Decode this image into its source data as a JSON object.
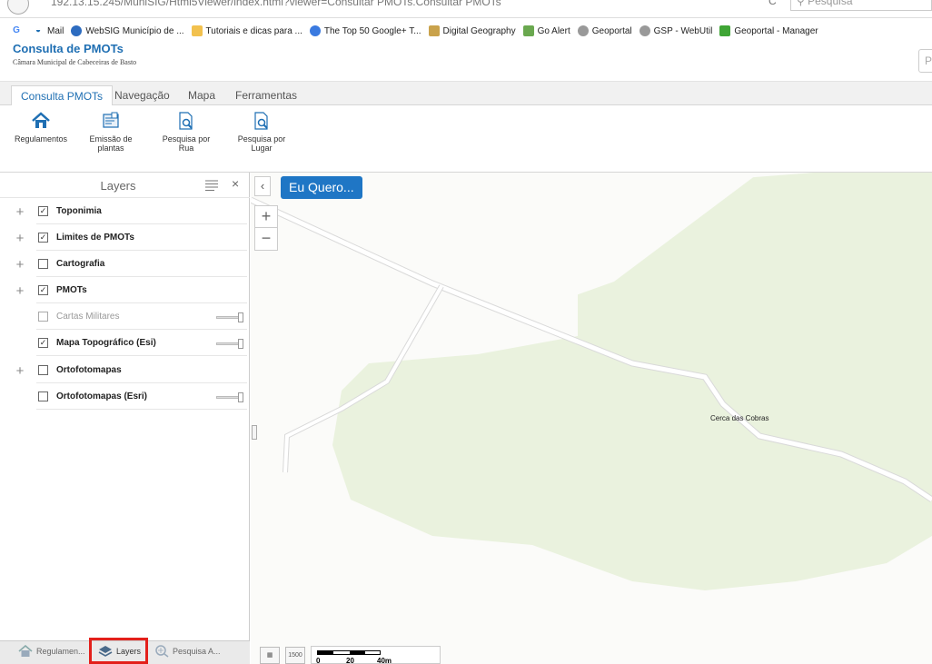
{
  "browser": {
    "url": "192.13.15.245/MuniSIG/Html5Viewer/index.html?viewer=Consultar PMOTs.Consultar PMOTs",
    "search_placeholder": "Pesquisa",
    "bookmarks": [
      {
        "label": "Mail",
        "icon": "google-icon"
      },
      {
        "label": "WebSIG Município de ...",
        "icon": "globe-icon"
      },
      {
        "label": "Tutoriais e dicas para ...",
        "icon": "folder-icon"
      },
      {
        "label": "The Top 50 Google+ T...",
        "icon": "blog-icon"
      },
      {
        "label": "Digital Geography",
        "icon": "dg-icon"
      },
      {
        "label": "Go Alert",
        "icon": "alert-icon"
      },
      {
        "label": "Geoportal",
        "icon": "globe-icon"
      },
      {
        "label": "GSP - WebUtil",
        "icon": "globe-icon"
      },
      {
        "label": "Geoportal - Manager",
        "icon": "manager-icon"
      }
    ]
  },
  "app": {
    "title": "Consulta de PMOTs",
    "subtitle": "Câmara Municipal de Cabeceiras de Basto",
    "search_placeholder": "P"
  },
  "ribbon": {
    "tabs": [
      "Consulta PMOTs",
      "Navegação",
      "Mapa",
      "Ferramentas"
    ],
    "buttons": [
      {
        "label1": "Regulamentos",
        "label2": "",
        "icon": "home-icon"
      },
      {
        "label1": "Emissão de",
        "label2": "plantas",
        "icon": "map-print-icon"
      },
      {
        "label1": "Pesquisa por",
        "label2": "Rua",
        "icon": "search-doc-icon"
      },
      {
        "label1": "Pesquisa por",
        "label2": "Lugar",
        "icon": "search-doc-icon"
      }
    ]
  },
  "layers_panel": {
    "title": "Layers",
    "layers": [
      {
        "label": "Toponimia",
        "checked": true,
        "expandable": true,
        "slider": false,
        "dim": false
      },
      {
        "label": "Limites de PMOTs",
        "checked": true,
        "expandable": true,
        "slider": false,
        "dim": false
      },
      {
        "label": "Cartografia",
        "checked": false,
        "expandable": true,
        "slider": false,
        "dim": false
      },
      {
        "label": "PMOTs",
        "checked": true,
        "expandable": true,
        "slider": false,
        "dim": false
      },
      {
        "label": "Cartas Militares",
        "checked": false,
        "expandable": false,
        "slider": true,
        "dim": true
      },
      {
        "label": "Mapa Topográfico (Esi)",
        "checked": true,
        "expandable": false,
        "slider": true,
        "dim": false
      },
      {
        "label": "Ortofotomapas",
        "checked": false,
        "expandable": true,
        "slider": false,
        "dim": false
      },
      {
        "label": "Ortofotomapas (Esri)",
        "checked": false,
        "expandable": false,
        "slider": true,
        "dim": false
      }
    ],
    "bottom_tabs": [
      "Regulamen...",
      "Layers",
      "Pesquisa A..."
    ]
  },
  "map": {
    "eu_quero": "Eu Quero...",
    "place_label": "Cerca das Cobras",
    "scale_labels": [
      "0",
      "20",
      "40m"
    ],
    "scale_button": "1500",
    "colors": {
      "forest": "#eaf2de",
      "road": "#ffffff",
      "road_edge": "#d9d9d9"
    }
  }
}
